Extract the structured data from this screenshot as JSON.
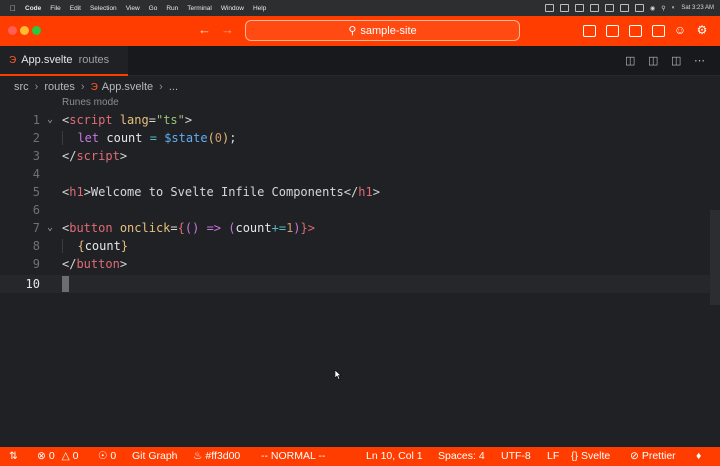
{
  "menubar": {
    "items": [
      "Code",
      "File",
      "Edit",
      "Selection",
      "View",
      "Go",
      "Run",
      "Terminal",
      "Window",
      "Help"
    ],
    "clock": "Sat 3:23 AM"
  },
  "titlebar": {
    "search_text": "sample-site",
    "accent": "#ff3d00"
  },
  "tabs": [
    {
      "name": "App.svelte",
      "description": "routes",
      "icon": "svelte-icon"
    }
  ],
  "breadcrumb": [
    "src",
    "routes",
    "App.svelte",
    "..."
  ],
  "editor": {
    "codelens": "Runes mode",
    "line_numbers": [
      "1",
      "2",
      "3",
      "4",
      "5",
      "6",
      "7",
      "8",
      "9",
      "10"
    ],
    "current_line": 10
  },
  "statusbar": {
    "remote": "",
    "errors": "0",
    "warnings": "0",
    "ports": "0",
    "git_graph": "Git Graph",
    "color": "#ff3d00",
    "vim_mode": "-- NORMAL --",
    "position": "Ln 10, Col 1",
    "spaces": "Spaces: 4",
    "encoding": "UTF-8",
    "eol": "LF",
    "language": "Svelte",
    "formatter": "Prettier"
  }
}
